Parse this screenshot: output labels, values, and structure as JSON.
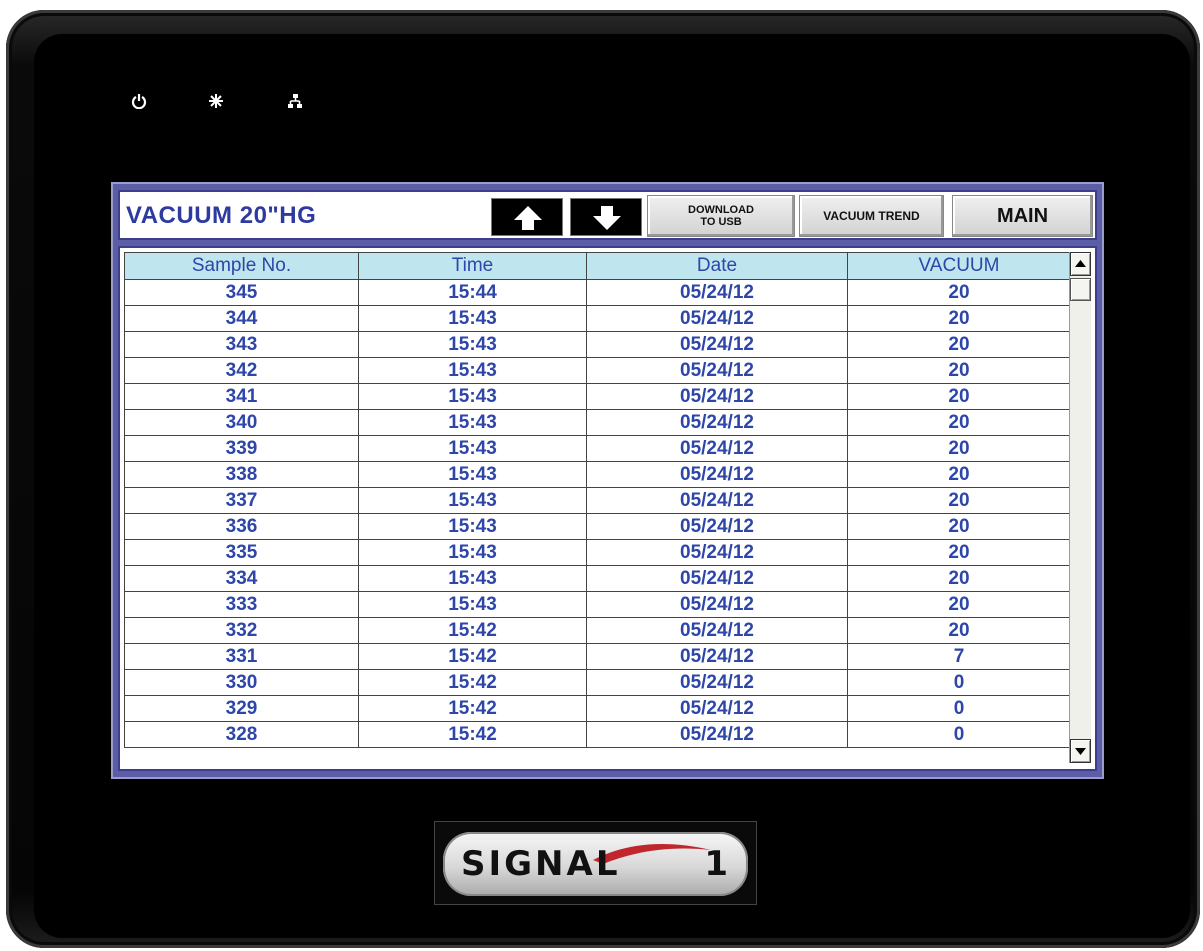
{
  "device": {
    "status_icons": [
      "power-icon",
      "asterisk-icon",
      "network-icon"
    ],
    "logo": {
      "text": "SIGNAL",
      "number": "1"
    }
  },
  "header": {
    "title": "VACUUM  20\"HG",
    "download_label_line1": "DOWNLOAD",
    "download_label_line2": "TO USB",
    "trend_label": "VACUUM TREND",
    "main_label": "MAIN"
  },
  "table": {
    "columns": [
      "Sample No.",
      "Time",
      "Date",
      "VACUUM"
    ],
    "rows": [
      [
        "345",
        "15:44",
        "05/24/12",
        "20"
      ],
      [
        "344",
        "15:43",
        "05/24/12",
        "20"
      ],
      [
        "343",
        "15:43",
        "05/24/12",
        "20"
      ],
      [
        "342",
        "15:43",
        "05/24/12",
        "20"
      ],
      [
        "341",
        "15:43",
        "05/24/12",
        "20"
      ],
      [
        "340",
        "15:43",
        "05/24/12",
        "20"
      ],
      [
        "339",
        "15:43",
        "05/24/12",
        "20"
      ],
      [
        "338",
        "15:43",
        "05/24/12",
        "20"
      ],
      [
        "337",
        "15:43",
        "05/24/12",
        "20"
      ],
      [
        "336",
        "15:43",
        "05/24/12",
        "20"
      ],
      [
        "335",
        "15:43",
        "05/24/12",
        "20"
      ],
      [
        "334",
        "15:43",
        "05/24/12",
        "20"
      ],
      [
        "333",
        "15:43",
        "05/24/12",
        "20"
      ],
      [
        "332",
        "15:42",
        "05/24/12",
        "20"
      ],
      [
        "331",
        "15:42",
        "05/24/12",
        "7"
      ],
      [
        "330",
        "15:42",
        "05/24/12",
        "0"
      ],
      [
        "329",
        "15:42",
        "05/24/12",
        "0"
      ],
      [
        "328",
        "15:42",
        "05/24/12",
        "0"
      ]
    ]
  },
  "colors": {
    "screen_bg": "#5b5ea7",
    "title_text": "#2d3aa0",
    "header_cell_bg": "#bfe6ee",
    "cell_text": "#2d46a8"
  }
}
